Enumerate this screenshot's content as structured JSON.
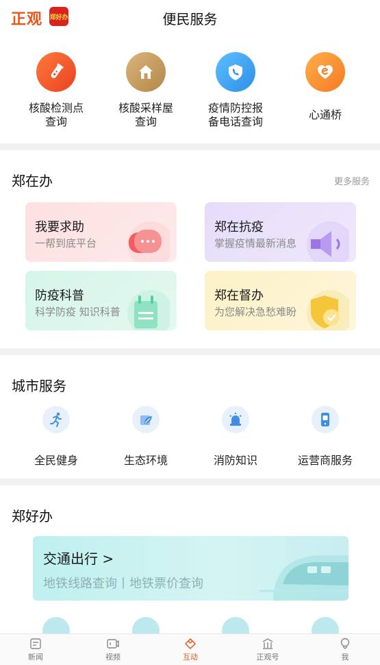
{
  "header": {
    "brand": "正观",
    "app_badge": "郑好办",
    "title": "便民服务"
  },
  "quick_services": [
    {
      "label": "核酸检测点\n查询",
      "icon": "test-tube-icon",
      "color": "#f0592a"
    },
    {
      "label": "核酸采样屋\n查询",
      "icon": "house-icon",
      "color": "#c59a5a"
    },
    {
      "label": "疫情防控报\n备电话查询",
      "icon": "shield-phone-icon",
      "color": "#3aa6f0"
    },
    {
      "label": "心通桥",
      "icon": "heart-icon",
      "color": "#f7862c"
    }
  ],
  "zhengzaiban": {
    "title": "郑在办",
    "more": "更多服务",
    "cards": [
      {
        "title": "我要求助",
        "subtitle": "一帮到底平台",
        "icon": "chat-bubble-icon",
        "bg": "#fde3e5",
        "accent": "#f07a7f"
      },
      {
        "title": "郑在抗疫",
        "subtitle": "掌握疫情最新消息",
        "icon": "megaphone-icon",
        "bg": "#ebe3fb",
        "accent": "#a77fe8"
      },
      {
        "title": "防疫科普",
        "subtitle": "科学防疫 知识科普",
        "icon": "notepad-icon",
        "bg": "#dcf6ec",
        "accent": "#4fd1a1"
      },
      {
        "title": "郑在督办",
        "subtitle": "为您解决急愁难盼",
        "icon": "shield-check-icon",
        "bg": "#fdf4d2",
        "accent": "#f5c53a"
      }
    ]
  },
  "city_services": {
    "title": "城市服务",
    "items": [
      {
        "label": "全民健身",
        "icon": "running-icon"
      },
      {
        "label": "生态环境",
        "icon": "leaf-icon"
      },
      {
        "label": "消防知识",
        "icon": "alarm-icon"
      },
      {
        "label": "运营商服务",
        "icon": "phone-icon"
      }
    ]
  },
  "zhenghaoban": {
    "title": "郑好办",
    "banner_title": "交通出行 >",
    "banner_subtitle": "地铁线路查询丨地铁票价查询"
  },
  "bottom_nav": [
    {
      "label": "新闻",
      "icon": "news-icon",
      "active": false
    },
    {
      "label": "视频",
      "icon": "video-icon",
      "active": false
    },
    {
      "label": "互动",
      "icon": "interact-icon",
      "active": true
    },
    {
      "label": "正观号",
      "icon": "building-icon",
      "active": false
    },
    {
      "label": "我",
      "icon": "profile-icon",
      "active": false
    }
  ],
  "colors": {
    "brand": "#e8541c",
    "section_divider": "#f1f1f1",
    "service_icon_blue": "#3f8fe0"
  }
}
